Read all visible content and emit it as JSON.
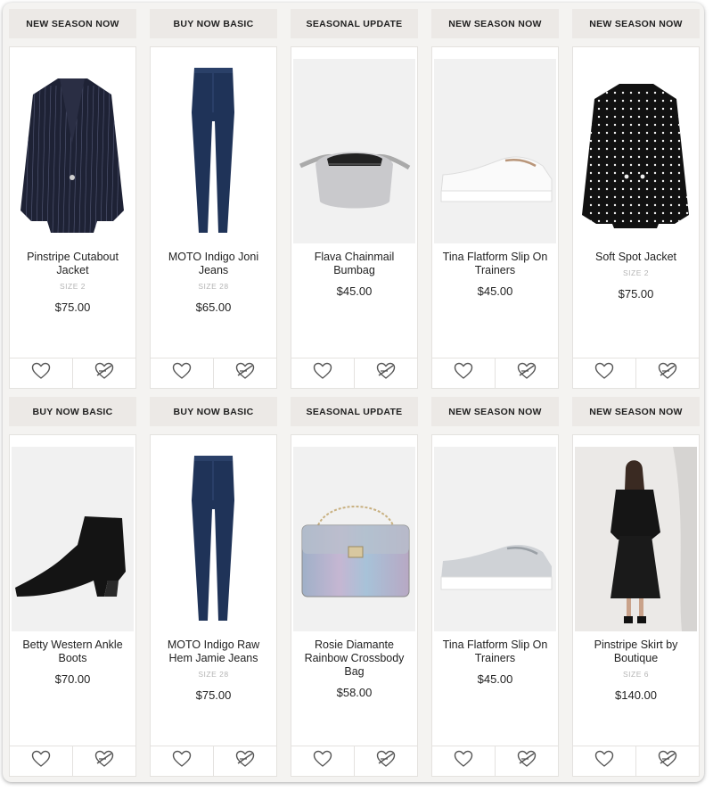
{
  "products": [
    {
      "tag": "NEW SEASON NOW",
      "name": "Pinstripe Cutabout Jacket",
      "size": "SIZE 2",
      "price": "$75.00",
      "image": "pinstripe-jacket"
    },
    {
      "tag": "BUY NOW BASIC",
      "name": "MOTO Indigo Joni Jeans",
      "size": "SIZE 28",
      "price": "$65.00",
      "image": "jeans"
    },
    {
      "tag": "SEASONAL UPDATE",
      "name": "Flava Chainmail Bumbag",
      "size": "",
      "price": "$45.00",
      "image": "bumbag"
    },
    {
      "tag": "NEW SEASON NOW",
      "name": "Tina Flatform Slip On Trainers",
      "size": "",
      "price": "$45.00",
      "image": "white-trainers"
    },
    {
      "tag": "NEW SEASON NOW",
      "name": "Soft Spot Jacket",
      "size": "SIZE 2",
      "price": "$75.00",
      "image": "polka-jacket"
    },
    {
      "tag": "BUY NOW BASIC",
      "name": "Betty Western Ankle Boots",
      "size": "",
      "price": "$70.00",
      "image": "ankle-boot"
    },
    {
      "tag": "BUY NOW BASIC",
      "name": "MOTO Indigo Raw Hem Jamie Jeans",
      "size": "SIZE 28",
      "price": "$75.00",
      "image": "jeans"
    },
    {
      "tag": "SEASONAL UPDATE",
      "name": "Rosie Diamante Rainbow Crossbody Bag",
      "size": "",
      "price": "$58.00",
      "image": "crossbody-bag"
    },
    {
      "tag": "NEW SEASON NOW",
      "name": "Tina Flatform Slip On Trainers",
      "size": "",
      "price": "$45.00",
      "image": "grey-trainers"
    },
    {
      "tag": "NEW SEASON NOW",
      "name": "Pinstripe Skirt by Boutique",
      "size": "SIZE 6",
      "price": "$140.00",
      "image": "model-skirt"
    }
  ],
  "icons": {
    "wishlist": "heart-icon",
    "dislike": "broken-heart-icon"
  },
  "colors": {
    "tag_bg": "#ece9e6",
    "page_bg": "#f4f3f1",
    "card_bg": "#ffffff"
  }
}
